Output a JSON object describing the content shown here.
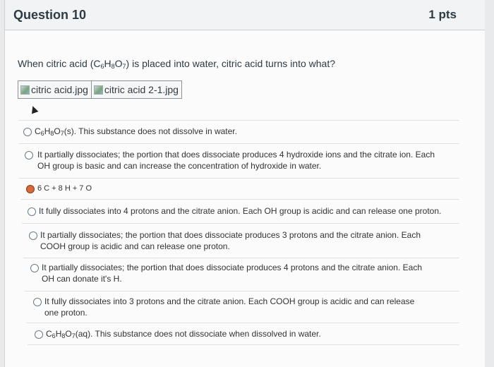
{
  "question": {
    "title": "Question 10",
    "points": "1 pts",
    "text_before": "When citric acid (C",
    "sub1": "6",
    "mid1": "H",
    "sub2": "8",
    "mid2": "O",
    "sub3": "7",
    "text_after": ") is placed into water, citric acid turns into what?",
    "images": [
      "citric acid.jpg",
      "citric acid 2-1.jpg"
    ]
  },
  "options": [
    {
      "a": "C",
      "s1": "6",
      "b": "H",
      "s2": "8",
      "c": "O",
      "s3": "7",
      "d": "(s). This substance does not dissolve in water.",
      "selected": false
    },
    {
      "text": "It partially dissociates; the portion that does dissociate produces 4 hydroxide ions and the citrate ion. Each OH group is basic and can increase the concentration of hydroxide in water.",
      "selected": false
    },
    {
      "text": "6 C + 8 H + 7 O",
      "selected": true
    },
    {
      "text": "It fully dissociates into 4 protons and the citrate anion. Each OH group is acidic and can release one proton.",
      "selected": false
    },
    {
      "text": "It partially dissociates; the portion that does dissociate produces 3 protons and the citrate anion. Each COOH group is acidic and can release one proton.",
      "selected": false
    },
    {
      "text": "It partially dissociates; the portion that does dissociate produces 4 protons and the citrate anion. Each OH can donate it's H.",
      "selected": false
    },
    {
      "text": "It fully dissociates into 3 protons and the citrate anion. Each COOH group is acidic and can release one proton.",
      "selected": false
    },
    {
      "a": "C",
      "s1": "6",
      "b": "H",
      "s2": "8",
      "c": "O",
      "s3": "7",
      "d": "(aq). This substance does not dissociate when dissolved in water.",
      "selected": false
    }
  ],
  "colors": {
    "selected_radio": "#d9683b",
    "header_bg": "#f2f3f4"
  }
}
